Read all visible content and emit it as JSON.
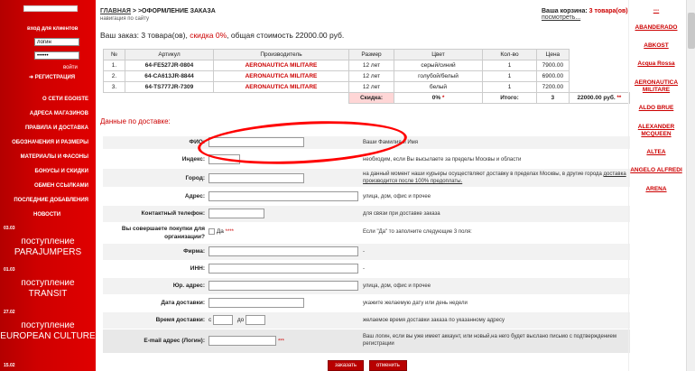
{
  "sidebar": {
    "search_link": "искать",
    "login_title": "вход для клиентов",
    "login_value": "логин",
    "password_mask": "••••••",
    "login_button": "войти",
    "register": "РЕГИСТРАЦИЯ",
    "menu": [
      "О СЕТИ EGOISTE",
      "АДРЕСА МАГАЗИНОВ",
      "ПРАВИЛА И ДОСТАВКА",
      "ОБОЗНАЧЕНИЯ И РАЗМЕРЫ",
      "МАТЕРИАЛЫ И ФАСОНЫ",
      "БОНУСЫ И СКИДКИ",
      "ОБМЕН ССЫЛКАМИ",
      "ПОСЛЕДНИЕ ДОБАВЛЕНИЯ"
    ],
    "news_title": "НОВОСТИ",
    "news": [
      {
        "date": "03.03",
        "text1": "поступление",
        "text2": "PARAJUMPERS"
      },
      {
        "date": "01.03",
        "text1": "поступление",
        "text2": "TRANSIT"
      },
      {
        "date": "27.02",
        "text1": "поступление",
        "text2": "EUROPEAN CULTURE"
      },
      {
        "date": "15.02",
        "text1": "",
        "text2": ""
      }
    ]
  },
  "header": {
    "breadcrumb_home": "ГЛАВНАЯ",
    "breadcrumb_sep": " > ",
    "breadcrumb_current": ">ОФОРМЛЕНИЕ ЗАКАЗА",
    "subnav": "навигация по сайту",
    "cart_label": "Ваша корзина: ",
    "cart_count": "3 товара(ов)",
    "cart_view": "посмотреть..."
  },
  "summary": {
    "prefix": "Ваш заказ: 3 товара(ов), ",
    "discount": "скидка 0%",
    "suffix": ", общая стоимость 22000.00 руб."
  },
  "order_table": {
    "headers": [
      "№",
      "Артикул",
      "Производитель",
      "Размер",
      "Цвет",
      "Кол-во",
      "Цена"
    ],
    "rows": [
      [
        "1.",
        "64-FE527JR-0804",
        "AERONAUTICA MILITARE",
        "12 лет",
        "серый/синий",
        "1",
        "7900.00"
      ],
      [
        "2.",
        "64-CA613JR-8844",
        "AERONAUTICA MILITARE",
        "12 лет",
        "голубой/белый",
        "1",
        "6900.00"
      ],
      [
        "3.",
        "64-TS777JR-7309",
        "AERONAUTICA MILITARE",
        "12 лет",
        "белый",
        "1",
        "7200.00"
      ]
    ],
    "discount_label": "Скидка:",
    "discount_value": "0%",
    "total_label": "Итого:",
    "total_qty": "3",
    "total_price": "22000.00 руб."
  },
  "delivery": {
    "title": "Данные по доставке:",
    "fields": [
      {
        "label": "ФИО:",
        "hint": "Ваши Фамилия и Имя"
      },
      {
        "label": "Индекс:",
        "hint": "необходим, если Вы высылаете за пределы Москвы и области"
      },
      {
        "label": "Город:",
        "hint": "на данный момент наши курьеры осуществляют доставку в пределах Москвы, в другие города",
        "hint_link": "доставка производится после 100% предоплаты."
      },
      {
        "label": "Адрес:",
        "hint": "улица, дом, офис и прочее"
      },
      {
        "label": "Контактный телефон:",
        "hint": "для связи при доставке заказа"
      },
      {
        "label": "Вы совершаете покупки для организации?",
        "hint": "Если \"Да\" то заполните следующие 3 поля:",
        "option": "Да"
      },
      {
        "label": "Фирма:",
        "hint": "-"
      },
      {
        "label": "ИНН:",
        "hint": "-"
      },
      {
        "label": "Юр. адрес:",
        "hint": "улица, дом, офис и прочее"
      },
      {
        "label": "Дата доставки:",
        "hint": "укажите желаемую дату или день недели"
      },
      {
        "label": "Время доставки:",
        "hint": "желаемое время доставки заказа по указанному адресу",
        "from": "с",
        "to": "до"
      },
      {
        "label": "E-mail адрес (Логин):",
        "hint": "Ваш логин, если вы уже имеет аккаунт, или новый,на него будет выслано письмо с подтверждением регистрации"
      }
    ],
    "submit": "заказать",
    "cancel": "отменить"
  },
  "brands": [
    "---",
    "ABANDERADO",
    "ABKOST",
    "Acqua Rossa",
    "AERONAUTICA MILITARE",
    "ALDO BRUE",
    "ALEXANDER MCQUEEN",
    "ALTEA",
    "ANGELO ALFREDI",
    "ARENA"
  ]
}
